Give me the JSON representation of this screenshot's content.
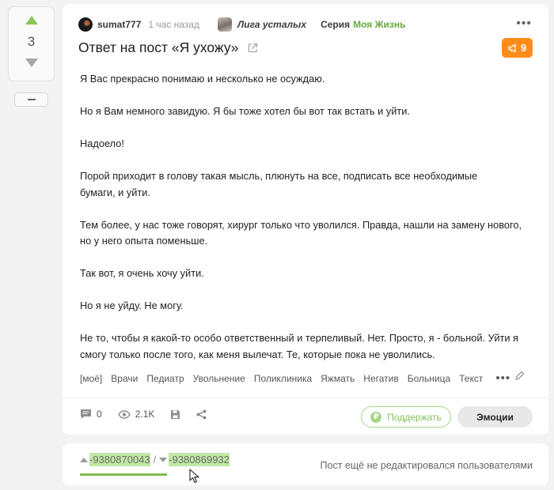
{
  "rating": {
    "value": "3",
    "collapse_label": "—"
  },
  "post": {
    "author": "sumat777",
    "time": "1 час назад",
    "community": "Лига усталых",
    "series_label": "Серия",
    "series_name": "Моя Жизнь",
    "title": "Ответ на пост «Я ухожу»",
    "badge_count": "9",
    "paragraphs": [
      "Я Вас прекрасно понимаю и несколько не осуждаю.",
      "Но я Вам немного завидую. Я бы тоже хотел бы вот так встать и уйти.",
      "Надоело!",
      "Порой приходит в голову такая мысль, плюнуть на все, подписать все необходимые бумаги, и уйти.",
      "Тем более, у нас тоже говорят, хирург только что уволился. Правда, нашли на замену нового, но у него опыта поменьше.",
      "Так вот, я очень хочу уйти.",
      "Но я не уйду. Не могу.",
      "Не то, чтобы я какой-то особо ответственный и терпеливый. Нет. Просто, я - больной. Уйти я смогу только после того, как меня вылечат. Те, которые пока не уволились."
    ],
    "tags": [
      "[моё]",
      "Врачи",
      "Педиатр",
      "Увольнение",
      "Поликлиника",
      "Яжмать",
      "Негатив",
      "Больница",
      "Текст"
    ],
    "comments_count": "0",
    "views_count": "2.1K",
    "donate_label": "Поддержать",
    "emotions_label": "Эмоции"
  },
  "footer": {
    "prev_id": "-9380870043",
    "separator": "/",
    "next_id": "-9380869932",
    "edit_note": "Пост ещё не редактировался пользователями"
  },
  "colors": {
    "accent_green": "#8ac858",
    "badge_orange": "#ff8d1a",
    "highlight": "#bfe8a4"
  },
  "icons": [
    "arrow-up-icon",
    "arrow-down-icon",
    "external-link-icon",
    "megaphone-icon",
    "comment-icon",
    "eye-icon",
    "save-icon",
    "share-icon",
    "pencil-icon",
    "ruble-icon",
    "more-dots-icon",
    "mouse-cursor-icon"
  ]
}
